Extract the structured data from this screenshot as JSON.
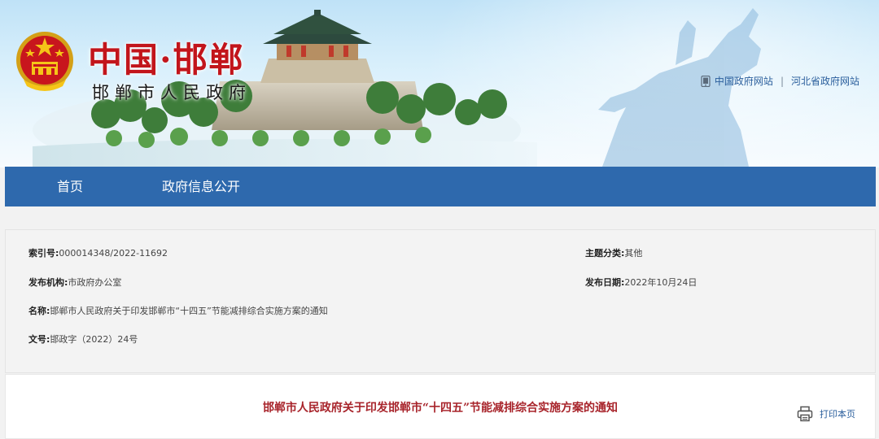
{
  "header": {
    "title": "中国·邯郸",
    "subtitle": "邯郸市人民政府",
    "links": [
      "中国政府网站",
      "河北省政府网站"
    ],
    "separator": "|"
  },
  "nav": {
    "items": [
      "首页",
      "政府信息公开"
    ]
  },
  "meta": {
    "index_label": "索引号:",
    "index_value": "000014348/2022-11692",
    "topic_label": "主题分类:",
    "topic_value": "其他",
    "org_label": "发布机构:",
    "org_value": "市政府办公室",
    "date_label": "发布日期:",
    "date_value": "2022年10月24日",
    "name_label": "名称:",
    "name_value": "邯郸市人民政府关于印发邯郸市“十四五”节能减排综合实施方案的通知",
    "docno_label": "文号:",
    "docno_value": "邯政字（2022）24号"
  },
  "content": {
    "title": "邯郸市人民政府关于印发邯郸市“十四五”节能减排综合实施方案的通知",
    "print_label": "打印本页"
  },
  "colors": {
    "nav_bg": "#2e69ad",
    "brand_red": "#c2151b",
    "link_blue": "#2a5e9c",
    "doc_title": "#a8242b"
  }
}
